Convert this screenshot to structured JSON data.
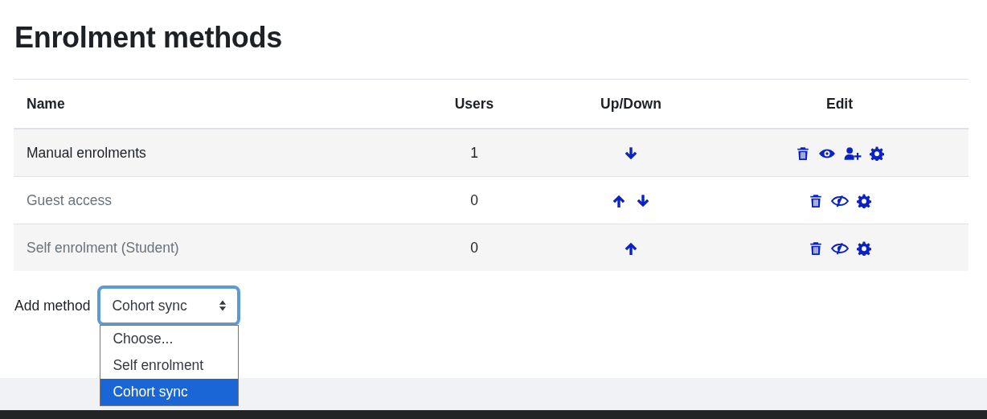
{
  "heading": "Enrolment methods",
  "table": {
    "columns": [
      "Name",
      "Users",
      "Up/Down",
      "Edit"
    ],
    "rows": [
      {
        "name": "Manual enrolments",
        "disabled": false,
        "users": "1",
        "up": false,
        "down": true,
        "actions": [
          {
            "kind": "delete"
          },
          {
            "kind": "visibility"
          },
          {
            "kind": "enrol"
          },
          {
            "kind": "settings"
          }
        ]
      },
      {
        "name": "Guest access",
        "disabled": true,
        "users": "0",
        "up": true,
        "down": true,
        "actions": [
          {
            "kind": "delete"
          },
          {
            "kind": "visibility"
          },
          {
            "kind": "settings"
          }
        ]
      },
      {
        "name": "Self enrolment (Student)",
        "disabled": true,
        "users": "0",
        "up": true,
        "down": false,
        "actions": [
          {
            "kind": "delete"
          },
          {
            "kind": "visibility"
          },
          {
            "kind": "settings"
          }
        ]
      }
    ]
  },
  "add_method": {
    "label": "Add method",
    "value": "Cohort sync",
    "focused": true,
    "options": [
      {
        "label": "Choose...",
        "selected": false
      },
      {
        "label": "Self enrolment",
        "selected": false
      },
      {
        "label": "Cohort sync",
        "selected": true
      }
    ]
  }
}
